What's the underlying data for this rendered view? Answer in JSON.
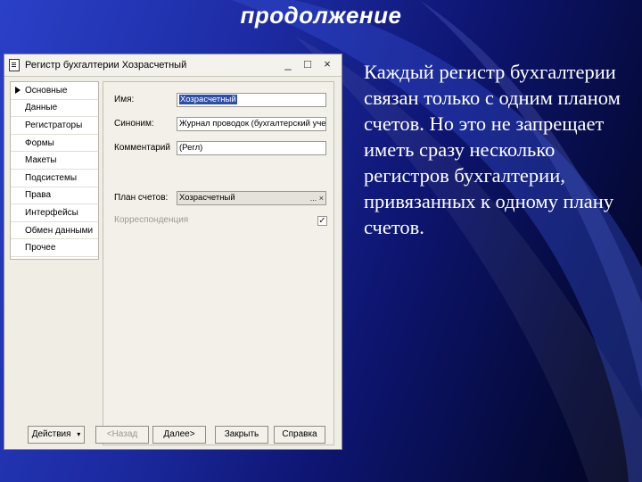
{
  "slide": {
    "title": "продолжение",
    "body": "Каждый регистр бухгалтерии связан только с одним планом счетов. Но это не запрещает иметь сразу несколько регистров бухгалтерии, привязанных к одному плану счетов."
  },
  "window": {
    "title": "Регистр бухгалтерии Хозрасчетный",
    "controls": {
      "minimize": "_",
      "maximize": "□",
      "close": "×"
    }
  },
  "sidebar": {
    "items": [
      {
        "label": "Основные",
        "active": true
      },
      {
        "label": "Данные"
      },
      {
        "label": "Регистраторы"
      },
      {
        "label": "Формы"
      },
      {
        "label": "Макеты"
      },
      {
        "label": "Подсистемы"
      },
      {
        "label": "Права"
      },
      {
        "label": "Интерфейсы"
      },
      {
        "label": "Обмен данными"
      },
      {
        "label": "Прочее"
      }
    ]
  },
  "form": {
    "name_label": "Имя:",
    "name_value": "Хозрасчетный",
    "synonym_label": "Синоним:",
    "synonym_value": "Журнал проводок (бухгалтерский учет)",
    "comment_label": "Комментарий",
    "comment_value": "(Регл)",
    "chart_label": "План счетов:",
    "chart_value": "Хозрасчетный",
    "chart_btns": "... ×",
    "correspondence_label": "Корреспонденция",
    "correspondence_checked": true,
    "check_mark": "✓"
  },
  "buttons": {
    "actions": "Действия",
    "actions_arrow": "▾",
    "back": "<Назад",
    "next": "Далее>",
    "close": "Закрыть",
    "help": "Справка"
  },
  "colors": {
    "background_left": "#2a40c8",
    "background_right": "#02041f",
    "text": "#ffffff"
  }
}
